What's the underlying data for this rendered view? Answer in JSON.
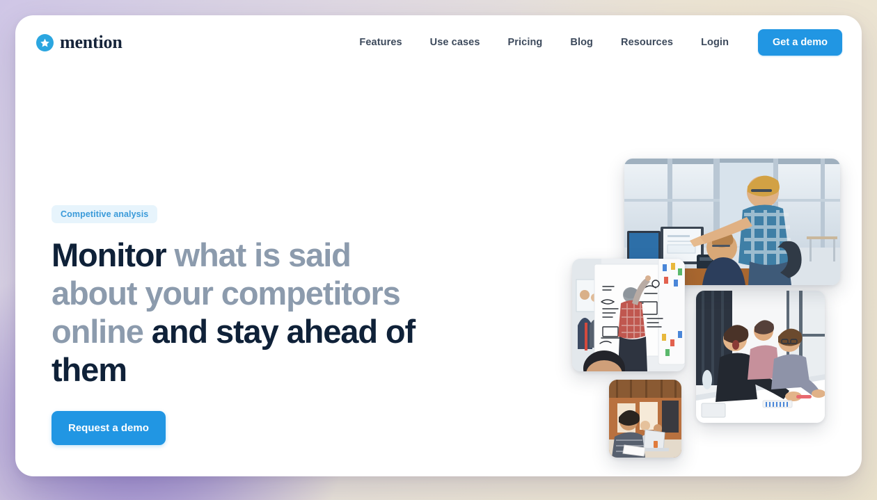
{
  "brand": {
    "name": "mention",
    "logo_icon": "star-in-circle-icon",
    "logo_color": "#2ba6e0"
  },
  "header": {
    "nav_items": [
      {
        "label": "Features"
      },
      {
        "label": "Use cases"
      },
      {
        "label": "Pricing"
      },
      {
        "label": "Blog"
      },
      {
        "label": "Resources"
      },
      {
        "label": "Login"
      }
    ],
    "cta_label": "Get a demo",
    "cta_color": "#2196e3"
  },
  "hero": {
    "badge": "Competitive analysis",
    "badge_text_color": "#3a9ad9",
    "badge_bg_color": "#e7f4fc",
    "title_part1": "Monitor",
    "title_part2": " what is said about your competitors online ",
    "title_part3": "and stay ahead of them",
    "title_dark_color": "#0f2138",
    "title_muted_color": "#8c9bad",
    "cta_label": "Request a demo"
  },
  "collage": {
    "photos": [
      {
        "name": "photo-office-pointing-at-monitor",
        "alt": "Two colleagues at a desk reviewing dashboards on monitors"
      },
      {
        "name": "photo-whiteboard-workshop",
        "alt": "Man sketching diagrams on a large whiteboard"
      },
      {
        "name": "photo-team-meeting-laughing",
        "alt": "Team laughing around a conference table"
      },
      {
        "name": "photo-woman-at-laptop",
        "alt": "Woman working at a laptop in an open office"
      }
    ]
  }
}
